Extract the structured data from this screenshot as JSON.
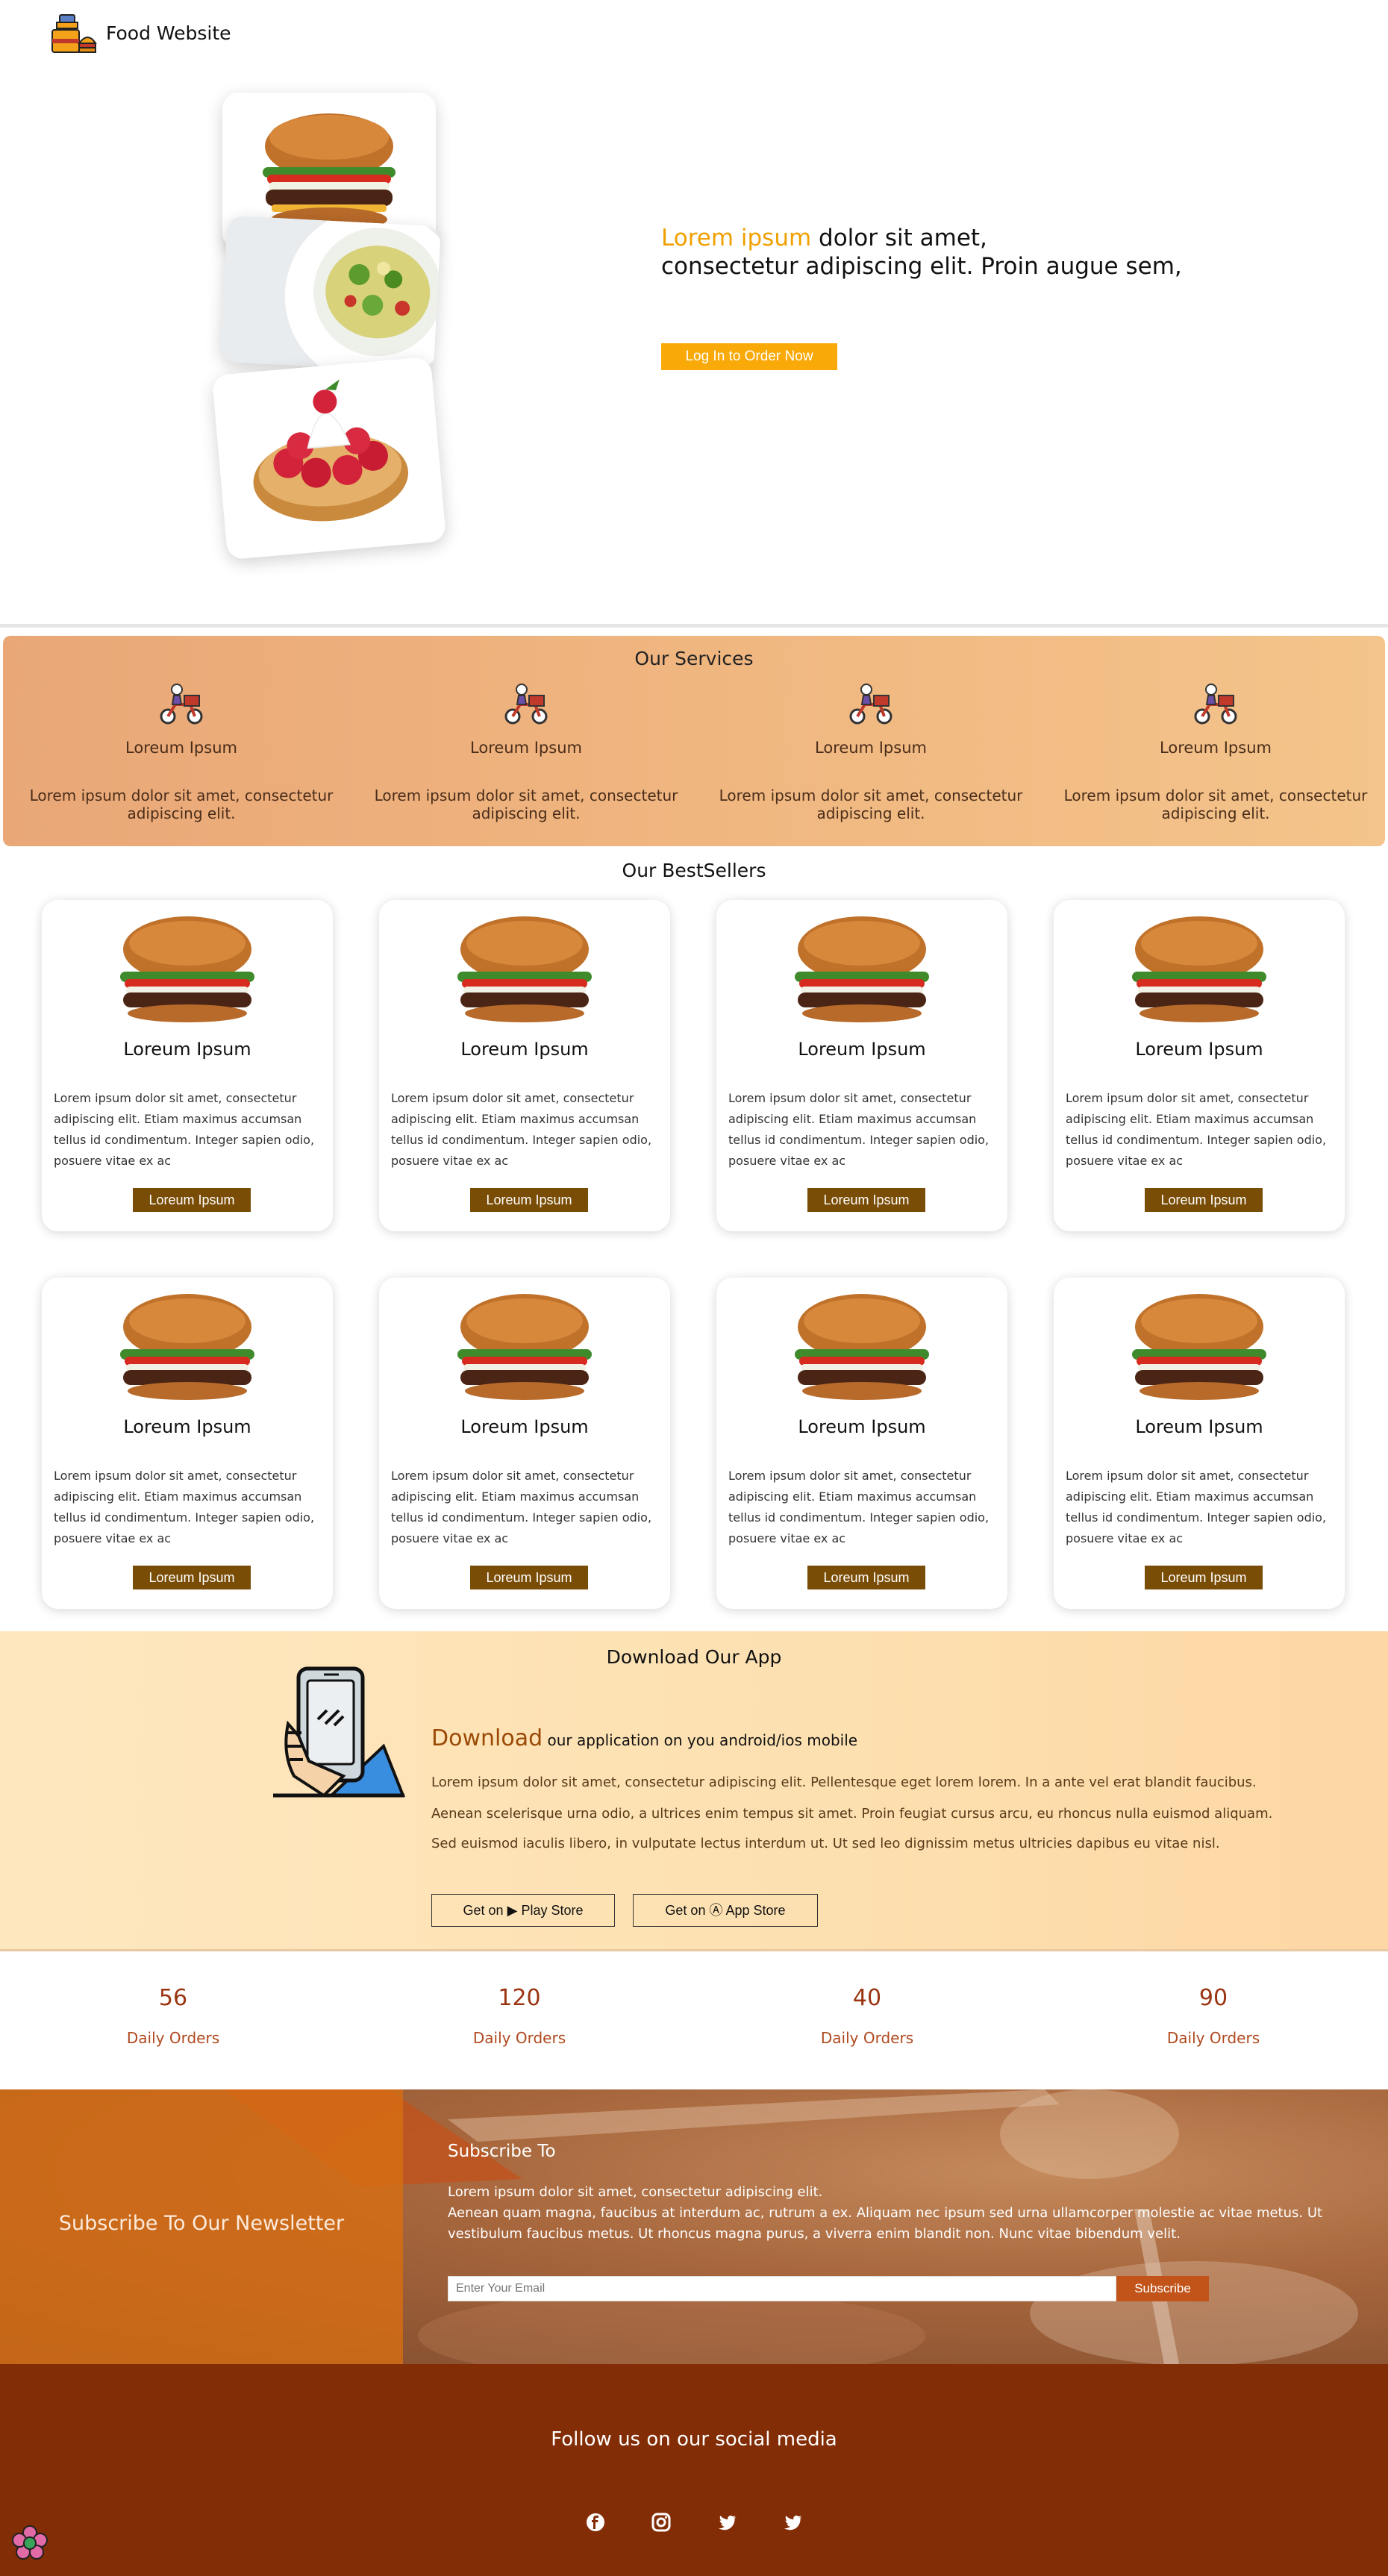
{
  "nav": {
    "brand": "Food Website",
    "logo_icon": "food-logo-icon"
  },
  "hero": {
    "accent": "Lorem ipsum",
    "line1_rest": "dolor sit amet,",
    "line2": "consectetur adipiscing elit. Proin augue sem,",
    "cta_label": "Log In to Order Now",
    "images": [
      "burger-image",
      "pasta-salad-image",
      "raspberry-tart-image"
    ]
  },
  "services": {
    "title": "Our Services",
    "items": [
      {
        "icon": "delivery-scooter-icon",
        "name": "Loreum Ipsum",
        "desc": "Lorem ipsum dolor sit amet, consectetur adipiscing elit."
      },
      {
        "icon": "delivery-scooter-icon",
        "name": "Loreum Ipsum",
        "desc": "Lorem ipsum dolor sit amet, consectetur adipiscing elit."
      },
      {
        "icon": "delivery-scooter-icon",
        "name": "Loreum Ipsum",
        "desc": "Lorem ipsum dolor sit amet, consectetur adipiscing elit."
      },
      {
        "icon": "delivery-scooter-icon",
        "name": "Loreum Ipsum",
        "desc": "Lorem ipsum dolor sit amet, consectetur adipiscing elit."
      }
    ]
  },
  "bestsellers": {
    "title": "Our BestSellers",
    "cards": [
      {
        "title": "Loreum Ipsum",
        "desc": "Lorem ipsum dolor sit amet, consectetur adipiscing elit. Etiam maximus accumsan tellus id condimentum. Integer sapien odio, posuere vitae ex ac",
        "button": "Loreum Ipsum"
      },
      {
        "title": "Loreum Ipsum",
        "desc": "Lorem ipsum dolor sit amet, consectetur adipiscing elit. Etiam maximus accumsan tellus id condimentum. Integer sapien odio, posuere vitae ex ac",
        "button": "Loreum Ipsum"
      },
      {
        "title": "Loreum Ipsum",
        "desc": "Lorem ipsum dolor sit amet, consectetur adipiscing elit. Etiam maximus accumsan tellus id condimentum. Integer sapien odio, posuere vitae ex ac",
        "button": "Loreum Ipsum"
      },
      {
        "title": "Loreum Ipsum",
        "desc": "Lorem ipsum dolor sit amet, consectetur adipiscing elit. Etiam maximus accumsan tellus id condimentum. Integer sapien odio, posuere vitae ex ac",
        "button": "Loreum Ipsum"
      },
      {
        "title": "Loreum Ipsum",
        "desc": "Lorem ipsum dolor sit amet, consectetur adipiscing elit. Etiam maximus accumsan tellus id condimentum. Integer sapien odio, posuere vitae ex ac",
        "button": "Loreum Ipsum"
      },
      {
        "title": "Loreum Ipsum",
        "desc": "Lorem ipsum dolor sit amet, consectetur adipiscing elit. Etiam maximus accumsan tellus id condimentum. Integer sapien odio, posuere vitae ex ac",
        "button": "Loreum Ipsum"
      },
      {
        "title": "Loreum Ipsum",
        "desc": "Lorem ipsum dolor sit amet, consectetur adipiscing elit. Etiam maximus accumsan tellus id condimentum. Integer sapien odio, posuere vitae ex ac",
        "button": "Loreum Ipsum"
      },
      {
        "title": "Loreum Ipsum",
        "desc": "Lorem ipsum dolor sit amet, consectetur adipiscing elit. Etiam maximus accumsan tellus id condimentum. Integer sapien odio, posuere vitae ex ac",
        "button": "Loreum Ipsum"
      }
    ]
  },
  "app": {
    "title": "Download Our App",
    "head_accent": "Download",
    "head_rest": "our application on you android/ios mobile",
    "paragraphs": [
      "Lorem ipsum dolor sit amet, consectetur adipiscing elit. Pellentesque eget lorem lorem. In a ante vel erat blandit faucibus.",
      "Aenean scelerisque urna odio, a ultrices enim tempus sit amet. Proin feugiat cursus arcu, eu rhoncus nulla euismod aliquam.",
      "Sed euismod iaculis libero, in vulputate lectus interdum ut. Ut sed leo dignissim metus ultricies dapibus eu vitae nisl."
    ],
    "play_prefix": "Get on",
    "play_label": "Play Store",
    "appstore_prefix": "Get on",
    "appstore_label": "App Store",
    "icon": "phone-in-hand-icon"
  },
  "stats": [
    {
      "value": "56",
      "label": "Daily Orders"
    },
    {
      "value": "120",
      "label": "Daily Orders"
    },
    {
      "value": "40",
      "label": "Daily Orders"
    },
    {
      "value": "90",
      "label": "Daily Orders"
    }
  ],
  "newsletter": {
    "left_title": "Subscribe To Our Newsletter",
    "title": "Subscribe To",
    "line1": "Lorem ipsum dolor sit amet, consectetur adipiscing elit.",
    "line2": "Aenean quam magna, faucibus at interdum ac, rutrum a ex. Aliquam nec ipsum sed urna ullamcorper molestie ac vitae metus. Ut vestibulum faucibus metus. Ut rhoncus magna purus, a viverra enim blandit non. Nunc vitae bibendum velit.",
    "email_placeholder": "Enter Your Email",
    "button": "Subscribe"
  },
  "footer": {
    "title": "Follow us on our social media",
    "icons": [
      "facebook-icon",
      "instagram-icon",
      "twitter-icon",
      "twitter-icon"
    ]
  },
  "colors": {
    "accent_orange": "#f9a908",
    "button_brown": "#7a4d06",
    "footer_bg": "#832d06",
    "stat_red": "#9a3411"
  }
}
